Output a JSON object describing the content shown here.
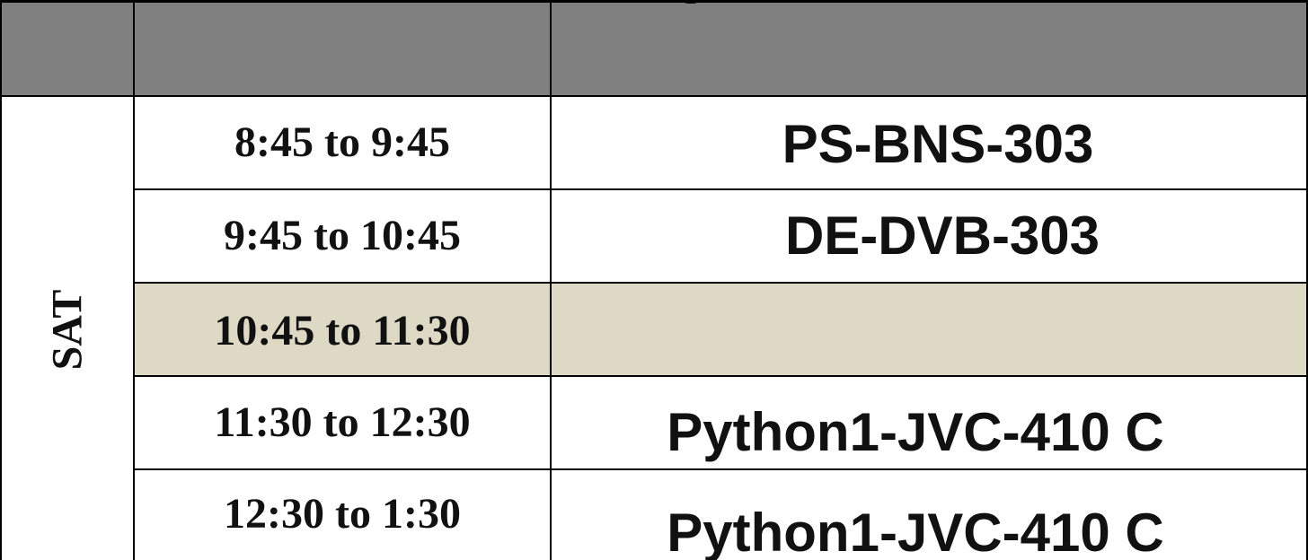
{
  "timetable": {
    "day": "SAT",
    "header": {
      "day_col": "",
      "time_col": "",
      "subject_col": ""
    },
    "rows": [
      {
        "time": "8:45 to 9:45",
        "subject": "PS-BNS-303",
        "is_break": false
      },
      {
        "time": "9:45 to 10:45",
        "subject": "DE-DVB-303",
        "is_break": false
      },
      {
        "time": "10:45 to 11:30",
        "subject": "",
        "is_break": true
      },
      {
        "time": "11:30 to 12:30",
        "subject": "Python1-JVC-410 C",
        "is_break": false
      },
      {
        "time": "12:30 to 1:30",
        "subject": "Python1-JVC-410 C",
        "is_break": false
      }
    ],
    "colors": {
      "header_bg": "#808080",
      "break_bg": "#ddd9c4",
      "border": "#000000"
    }
  }
}
